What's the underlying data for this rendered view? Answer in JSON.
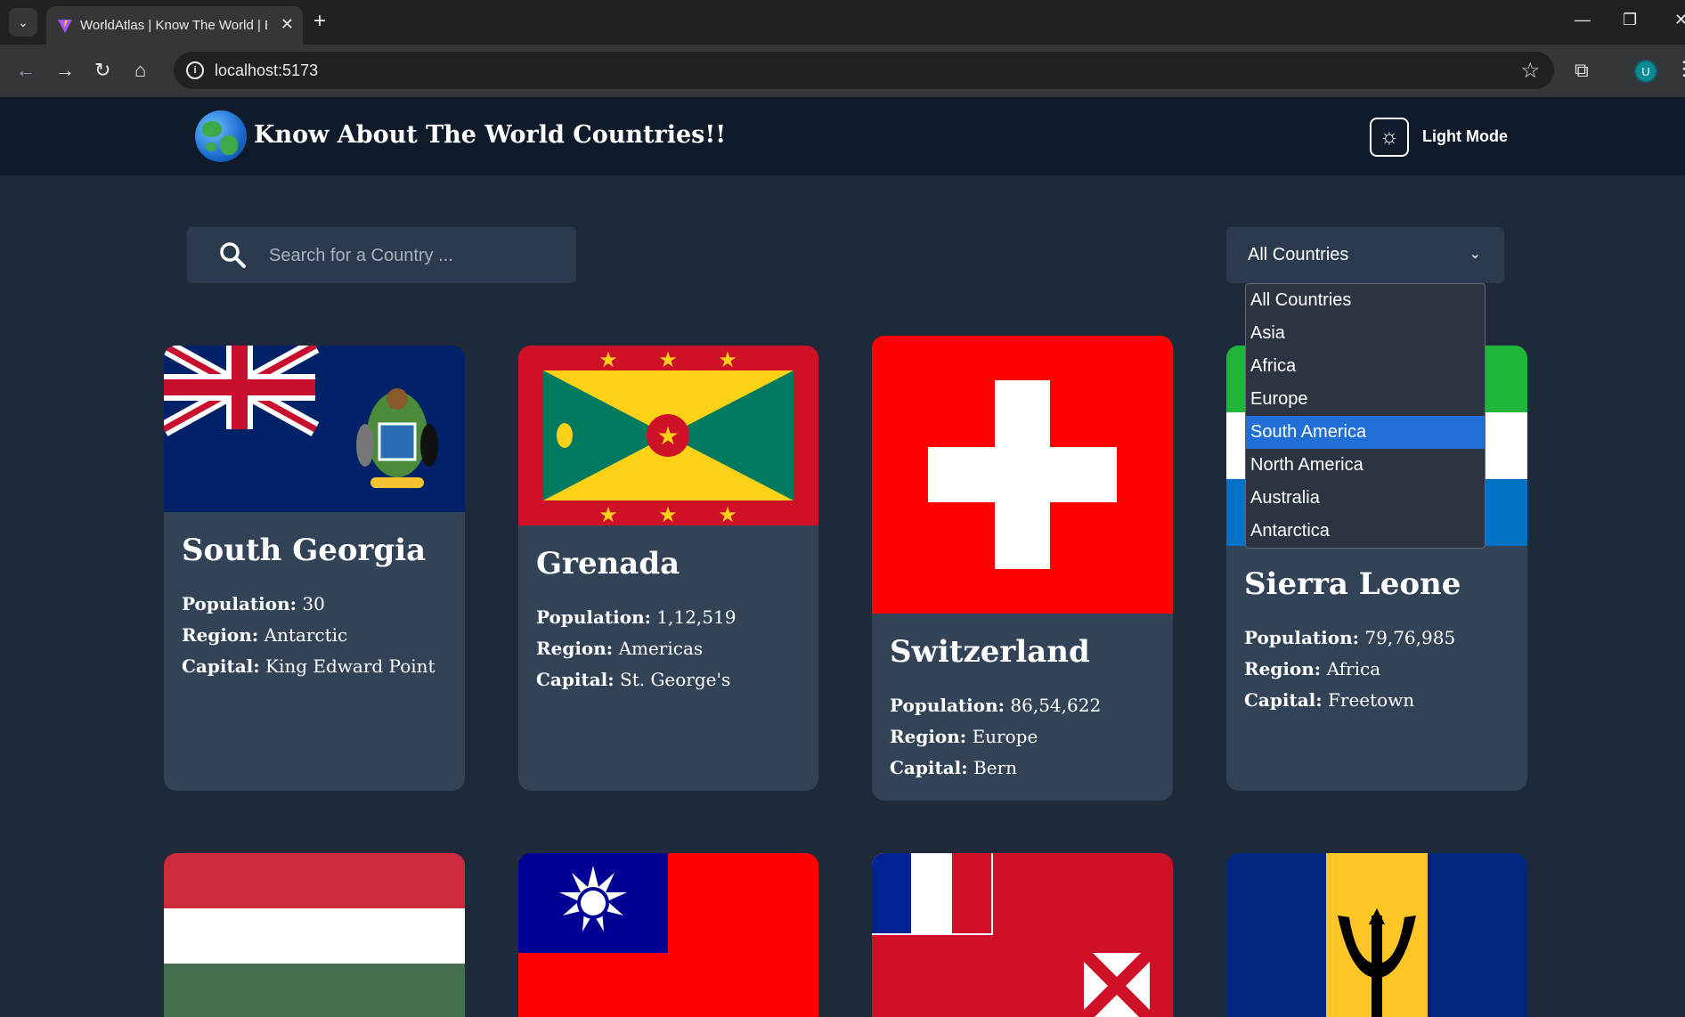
{
  "browser": {
    "tab_title": "WorldAtlas | Know The World | Ex",
    "url": "localhost:5173",
    "profile_initial": "U"
  },
  "header": {
    "title": "Know About The World Countries!!",
    "mode_label": "Light Mode"
  },
  "search": {
    "placeholder": "Search for a Country ..."
  },
  "filter": {
    "selected": "All Countries",
    "options": [
      "All Countries",
      "Asia",
      "Africa",
      "Europe",
      "South America",
      "North America",
      "Australia",
      "Antarctica"
    ],
    "highlighted": "South America"
  },
  "labels": {
    "population": "Population:",
    "region": "Region:",
    "capital": "Capital:"
  },
  "countries": [
    {
      "name": "South Georgia",
      "population": "30",
      "region": "Antarctic",
      "capital": "King Edward Point"
    },
    {
      "name": "Grenada",
      "population": "1,12,519",
      "region": "Americas",
      "capital": "St. George's"
    },
    {
      "name": "Switzerland",
      "population": "86,54,622",
      "region": "Europe",
      "capital": "Bern"
    },
    {
      "name": "Sierra Leone",
      "population": "79,76,985",
      "region": "Africa",
      "capital": "Freetown"
    }
  ],
  "colors": {
    "page_bg": "#1e2a3a",
    "header_bg": "#0f1a2b",
    "card_bg": "#324358",
    "highlight": "#1f6fd6"
  }
}
